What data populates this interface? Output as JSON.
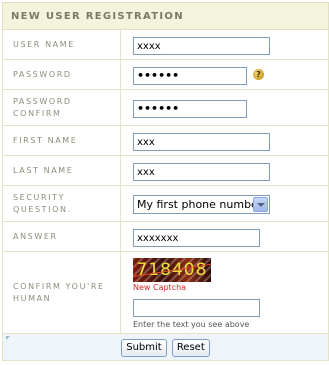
{
  "form": {
    "title": "NEW USER REGISTRATION",
    "labels": {
      "user_name": "USER NAME",
      "password": "PASSWORD",
      "password_confirm": "PASSWORD CONFIRM",
      "first_name": "FIRST NAME",
      "last_name": "LAST NAME",
      "security_question": "SECURITY QUESTION.",
      "answer": "ANSWER",
      "confirm_human": "CONFIRM YOU'RE HUMAN"
    },
    "values": {
      "user_name": "xxxx",
      "password": "••••••",
      "password_confirm": "••••••",
      "first_name": "xxx",
      "last_name": "xxx",
      "security_question": "My first phone number.",
      "answer": "xxxxxxx",
      "captcha_input": ""
    },
    "help_icon_glyph": "?",
    "captcha": {
      "code": "718408",
      "new_captcha_link": "New Captcha",
      "hint": "Enter the text you see above"
    },
    "buttons": {
      "submit": "Submit",
      "reset": "Reset"
    }
  },
  "colors": {
    "header_bg": "#f4f3dc",
    "label_text": "#8d8d7a",
    "footer_bg": "#eff4fa",
    "captcha_link": "#d12b2b"
  }
}
